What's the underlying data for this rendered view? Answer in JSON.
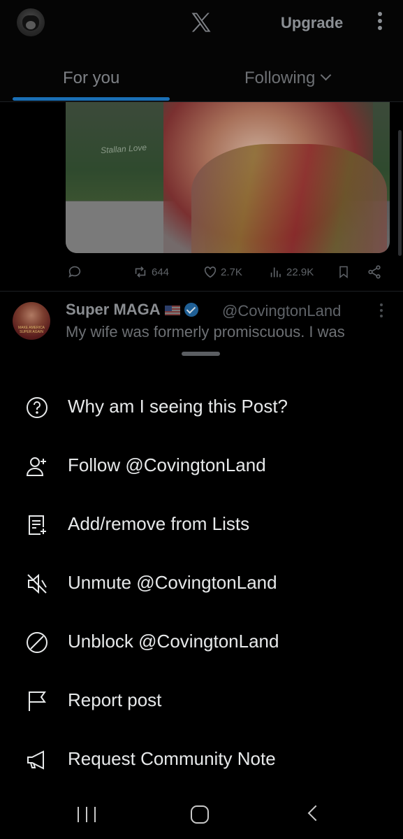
{
  "header": {
    "logo": "X",
    "upgrade_label": "Upgrade",
    "tabs": [
      {
        "label": "For you",
        "active": true
      },
      {
        "label": "Following",
        "active": false
      }
    ]
  },
  "post1": {
    "image_signature": "Stallan Love",
    "actions": {
      "reply": "",
      "reposts": "644",
      "likes": "2.7K",
      "views": "22.9K"
    }
  },
  "post2": {
    "display_name": "Super MAGA",
    "handle": "@CovingtonLand",
    "text": "My wife was formerly promiscuous. I was",
    "avatar_caption": "MAKE AMERICA SUPER AGAIN"
  },
  "sheet": {
    "items": [
      {
        "label": "Why am I seeing this Post?",
        "icon": "question-circle-icon"
      },
      {
        "label": "Follow @CovingtonLand",
        "icon": "user-plus-icon"
      },
      {
        "label": "Add/remove from Lists",
        "icon": "list-add-icon"
      },
      {
        "label": "Unmute @CovingtonLand",
        "icon": "speaker-muted-icon"
      },
      {
        "label": "Unblock @CovingtonLand",
        "icon": "blocked-icon"
      },
      {
        "label": "Report post",
        "icon": "flag-icon"
      },
      {
        "label": "Request Community Note",
        "icon": "megaphone-icon"
      }
    ]
  },
  "colors": {
    "accent": "#1d9bf0",
    "background": "#000000",
    "text": "#e7e9ea"
  }
}
